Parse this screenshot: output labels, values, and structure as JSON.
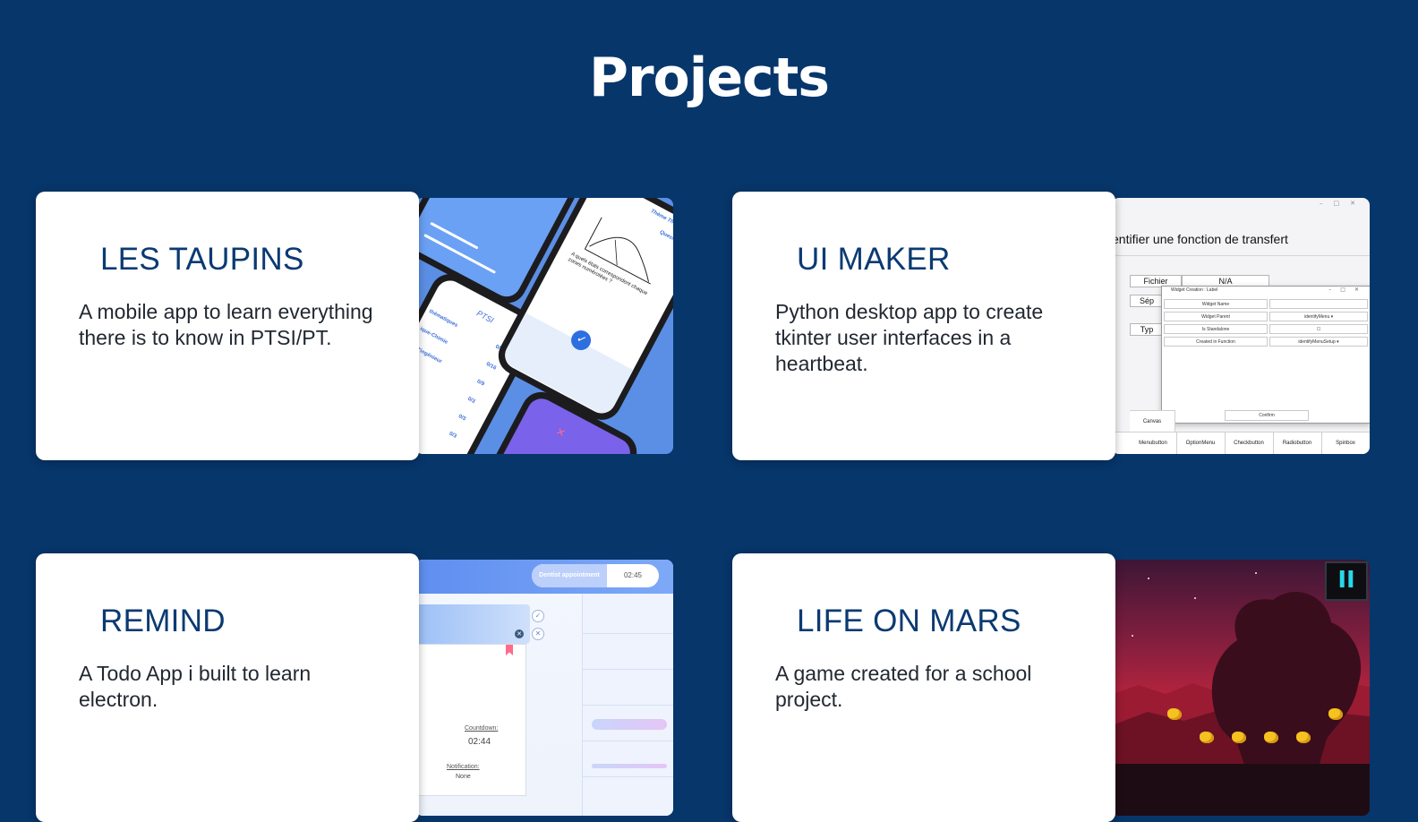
{
  "section": {
    "title": "Projects"
  },
  "projects": [
    {
      "title": "LES TAUPINS",
      "description": "A mobile app to learn everything there is to know in PTSI/PT.",
      "thumbnail_text": {
        "header": "PTSI",
        "rows": [
          "thématiques",
          "ique-Chimie",
          "de l'ingénieur"
        ],
        "scores": [
          "0/16",
          "0/16",
          "0/9",
          "0/3",
          "0/3",
          "0/3"
        ],
        "question_label": "Question",
        "question": "A quels états correspondent chaque zones numérotées ?",
        "theme": "Thème Thermo"
      }
    },
    {
      "title": "UI MAKER",
      "description": "Python desktop app to create tkinter user interfaces in a heartbeat.",
      "thumbnail_text": {
        "window_heading": "entifier une fonction de transfert",
        "fichier_label": "Fichier",
        "fichier_value": "N/A",
        "sep_label": "Sép",
        "type_label": "Typ",
        "dialog_title": "Widget Creation : Label",
        "dialog_rows": [
          {
            "label": "Widget Name",
            "value": ""
          },
          {
            "label": "Widget Parent",
            "value": "identifyMenu ▾"
          },
          {
            "label": "Is Standalone",
            "value": "☐"
          },
          {
            "label": "Created in Function",
            "value": "identifyMenuSetup ▾"
          }
        ],
        "confirm_label": "Confirm",
        "bottom_widgets": [
          "Menubutton",
          "OptionMenu",
          "Checkbutton",
          "Radiobutton",
          "Spinbox"
        ],
        "canvas_label": "Canvas"
      }
    },
    {
      "title": "REMIND",
      "description": "A Todo App i built to learn electron.",
      "thumbnail_text": {
        "pill_label": "Dentist appointment",
        "pill_time": "02:45",
        "countdown_label": "Countdown:",
        "countdown_value": "02:44",
        "notification_label": "Notification:",
        "notification_value": "None"
      }
    },
    {
      "title": "LIFE ON MARS",
      "description": "A game created for a school project.",
      "thumbnail_text": {
        "pause_symbol": "II"
      }
    }
  ]
}
